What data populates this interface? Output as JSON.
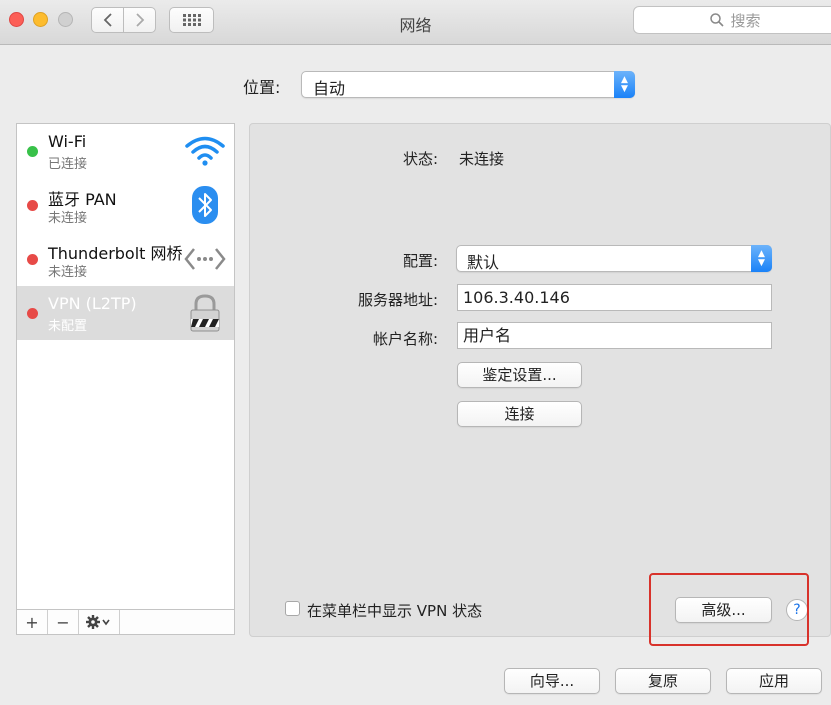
{
  "window": {
    "title": "网络"
  },
  "search": {
    "placeholder": "搜索"
  },
  "location": {
    "label": "位置:",
    "value": "自动"
  },
  "services": [
    {
      "name": "Wi-Fi",
      "status": "已连接",
      "indicator": "#38c149",
      "icon": "wifi-icon"
    },
    {
      "name": "蓝牙 PAN",
      "status": "未连接",
      "indicator": "#e74a47",
      "icon": "bluetooth-icon"
    },
    {
      "name": "Thunderbolt 网桥",
      "status": "未连接",
      "indicator": "#e74a47",
      "icon": "thunderbolt-bridge-icon"
    },
    {
      "name": "VPN (L2TP)",
      "status": "未配置",
      "indicator": "#e74a47",
      "icon": "vpn-lock-icon",
      "selected": true
    }
  ],
  "sidebar_tools": {
    "add": "+",
    "remove": "−"
  },
  "detail": {
    "status_label": "状态:",
    "status_value": "未连接",
    "config_label": "配置:",
    "config_value": "默认",
    "server_label": "服务器地址:",
    "server_value": "106.3.40.146",
    "account_label": "帐户名称:",
    "account_value": "用户名",
    "auth_button": "鉴定设置...",
    "connect_button": "连接",
    "show_vpn_status_label": "在菜单栏中显示 VPN 状态",
    "advanced_button": "高级...",
    "help": "?"
  },
  "footer": {
    "assist": "向导...",
    "revert": "复原",
    "apply": "应用"
  },
  "colors": {
    "accent": "#1a82f8",
    "highlight_box": "#d8322b"
  }
}
